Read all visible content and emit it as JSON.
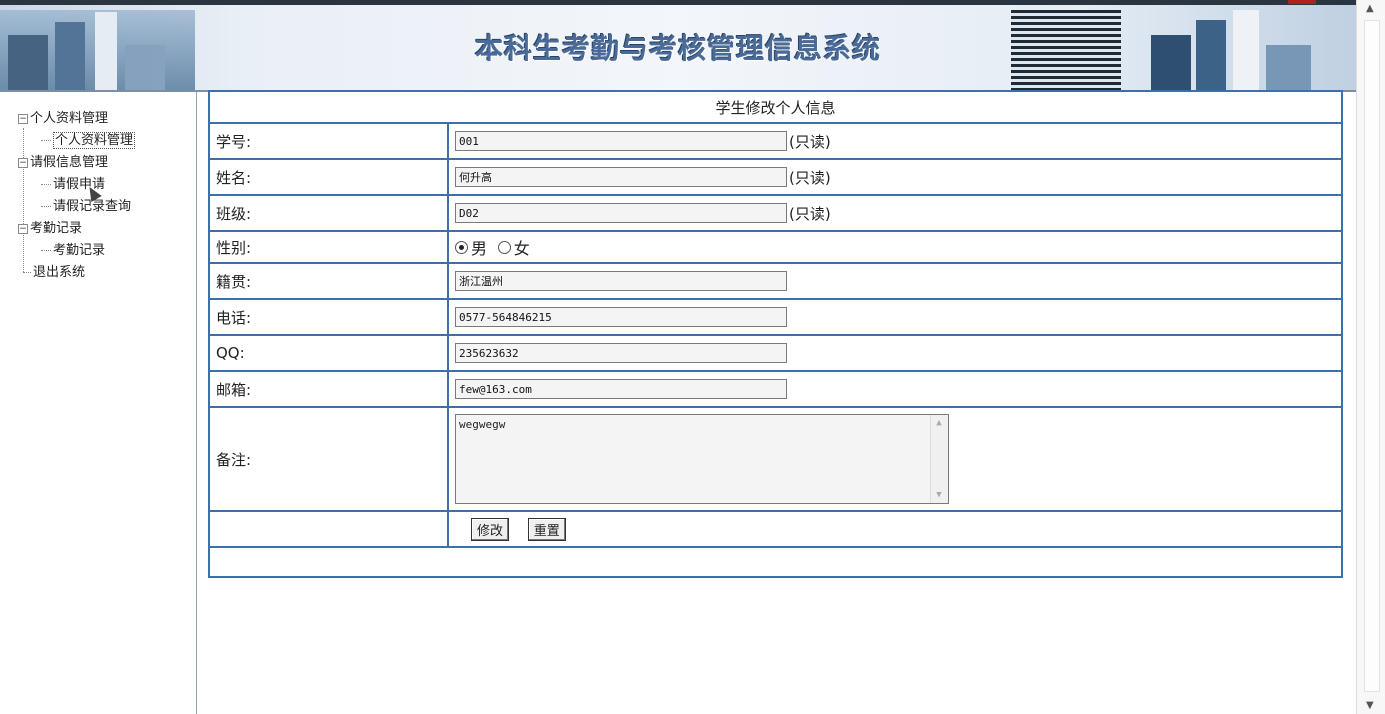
{
  "header": {
    "title": "本科生考勤与考核管理信息系统"
  },
  "sidebar": {
    "groups": [
      {
        "label": "个人资料管理",
        "children": [
          {
            "label": "个人资料管理",
            "selected": true
          }
        ]
      },
      {
        "label": "请假信息管理",
        "children": [
          {
            "label": "请假申请"
          },
          {
            "label": "请假记录查询"
          }
        ]
      },
      {
        "label": "考勤记录",
        "children": [
          {
            "label": "考勤记录"
          }
        ]
      }
    ],
    "exit_label": "退出系统",
    "toggle_glyph": "−"
  },
  "form": {
    "title": "学生修改个人信息",
    "readonly_suffix": "(只读)",
    "fields": {
      "student_id": {
        "label": "学号:",
        "value": "001"
      },
      "name": {
        "label": "姓名:",
        "value": "何升高"
      },
      "class": {
        "label": "班级:",
        "value": "D02"
      },
      "gender": {
        "label": "性别:",
        "options": [
          "男",
          "女"
        ],
        "selected": "男"
      },
      "hometown": {
        "label": "籍贯:",
        "value": "浙江温州"
      },
      "phone": {
        "label": "电话:",
        "value": "0577-564846215"
      },
      "qq": {
        "label": "QQ:",
        "value": "235623632"
      },
      "email": {
        "label": "邮箱:",
        "value": "few@163.com"
      },
      "remark": {
        "label": "备注:",
        "value": "wegwegw"
      }
    },
    "buttons": {
      "modify": "修改",
      "reset": "重置"
    }
  },
  "icons": {
    "scroll_up": "▲",
    "scroll_down": "▼"
  },
  "colors": {
    "table_border": "#3d6fa8",
    "title_text": "#4a6b98"
  }
}
